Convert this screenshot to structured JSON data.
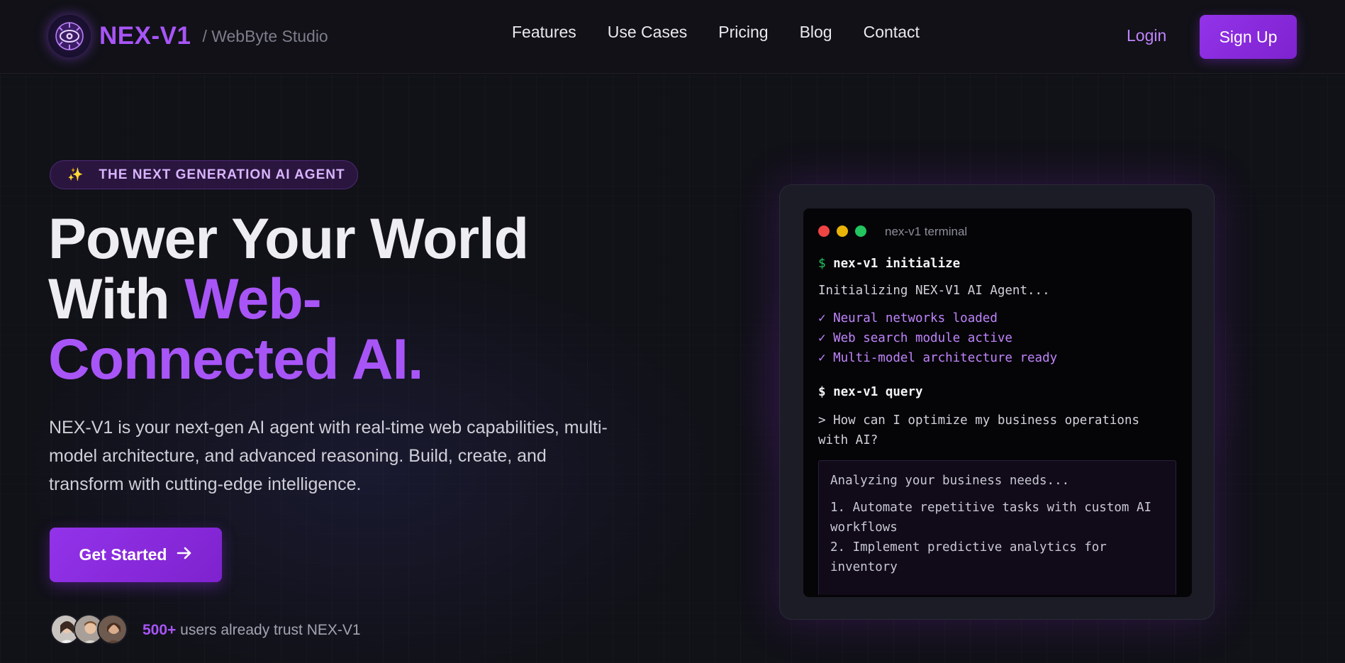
{
  "nav": {
    "brand": "NEX-V1",
    "studio": "/ WebByte Studio",
    "links": [
      "Features",
      "Use Cases",
      "Pricing",
      "Blog",
      "Contact"
    ],
    "login": "Login",
    "signup": "Sign Up"
  },
  "hero": {
    "badge_icon": "sparkles-icon",
    "badge": "THE NEXT GENERATION AI AGENT",
    "headline_1": "Power Your World",
    "headline_2": "With ",
    "headline_accent_1": "Web-",
    "headline_accent_2": "Connected AI.",
    "description": "NEX-V1 is your next-gen AI agent with real-time web capabilities, multi-model architecture, and advanced reasoning. Build, create, and transform with cutting-edge intelligence.",
    "cta": "Get Started",
    "trust_count": "500+",
    "trust_text": " users already trust NEX-V1"
  },
  "terminal": {
    "title": "nex-v1 terminal",
    "prompt": "$",
    "cmd1": "nex-v1 initialize",
    "line_init": "Initializing NEX-V1 AI Agent...",
    "checks": [
      "✓ Neural networks loaded",
      "✓ Web search module active",
      "✓ Multi-model architecture ready"
    ],
    "cmd2": "nex-v1 query",
    "query_1": "> How can I optimize my business operations",
    "query_2": "with AI?",
    "response": [
      "Analyzing your business needs...",
      "1. Automate repetitive tasks with custom AI",
      "workflows",
      "2. Implement predictive analytics for",
      "inventory"
    ]
  },
  "colors": {
    "accent": "#a855f7",
    "button": "#9333ea",
    "dot_red": "#ef4444",
    "dot_yellow": "#eab308",
    "dot_green": "#22c55e"
  }
}
